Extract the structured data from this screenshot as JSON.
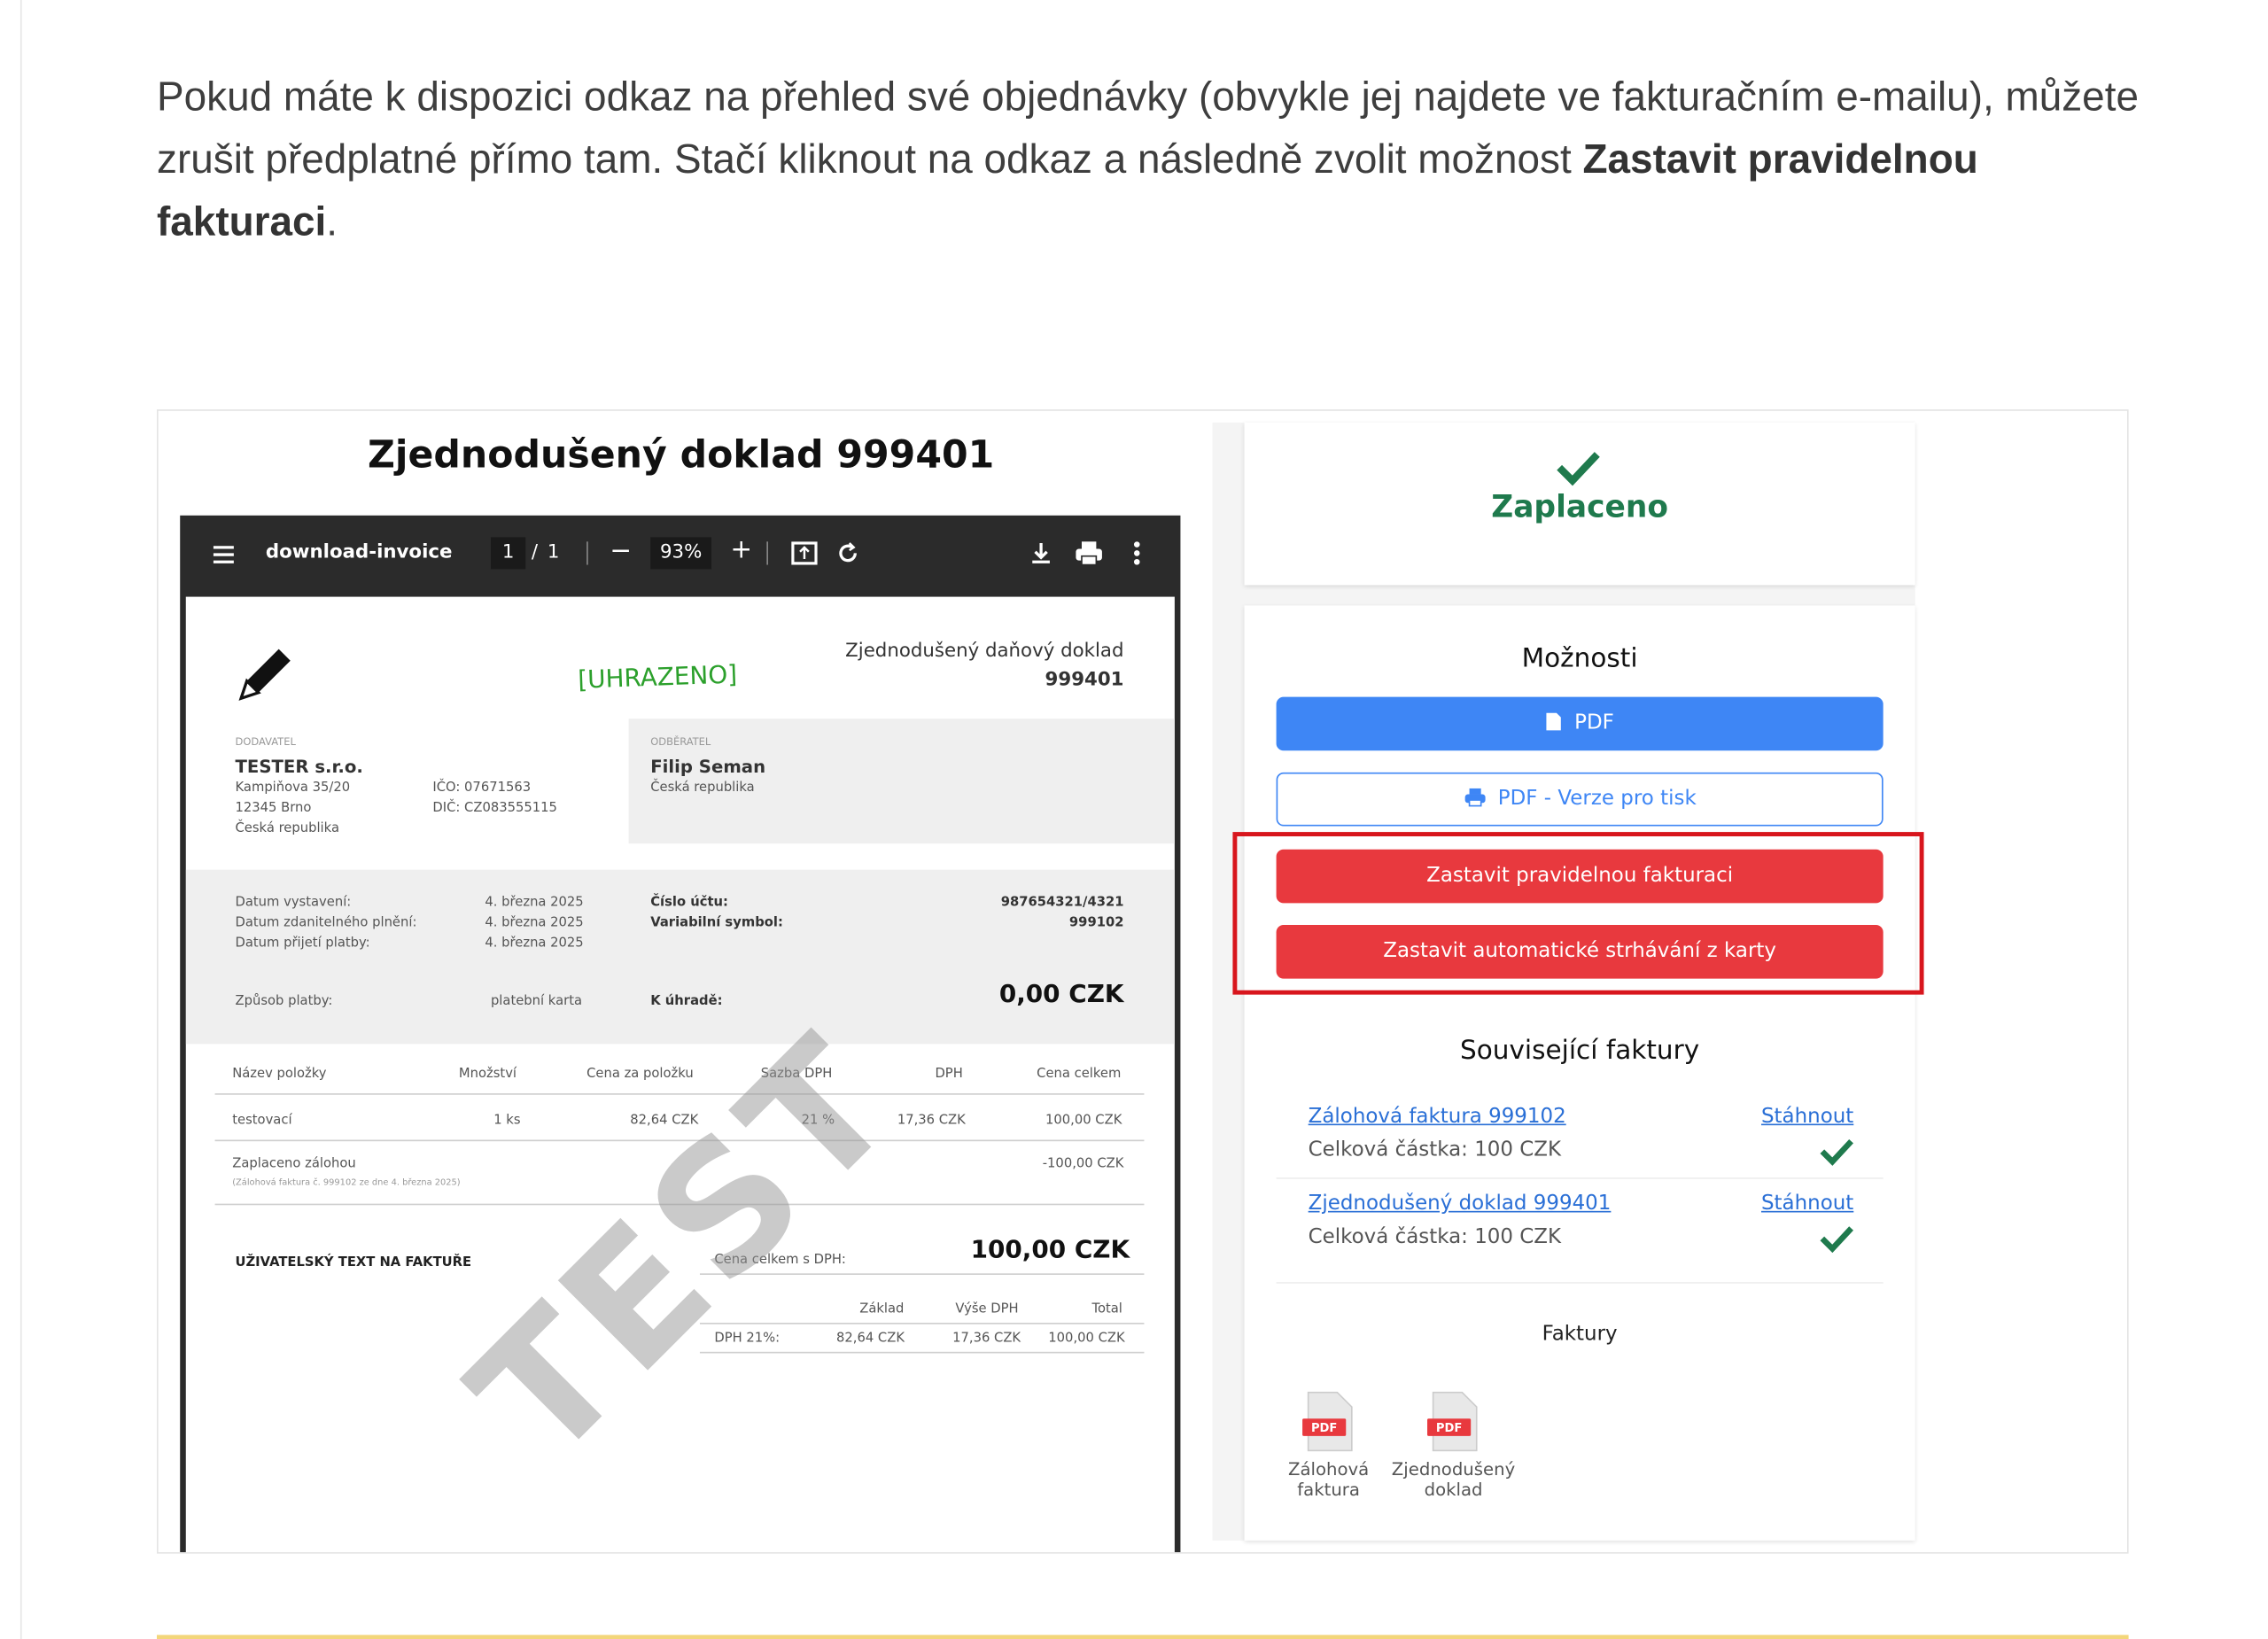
{
  "paragraph": {
    "text": "Pokud máte k dispozici odkaz na přehled své objednávky (obvykle jej najdete ve fakturačním e-mailu), můžete zrušit předplatné přímo tam. Stačí kliknout na odkaz a následně zvolit možnost ",
    "bold": "Zastavit pravidelnou fakturaci",
    "end": "."
  },
  "screenshot": {
    "title": "Zjednodušený doklad 999401",
    "viewer": {
      "filename": "download-invoice",
      "page_current": "1",
      "page_sep": "/",
      "page_total": "1",
      "zoom": "93%",
      "minus": "−",
      "plus": "+"
    },
    "invoice": {
      "stamp": "[UHRAZENO]",
      "doc_type": "Zjednodušený daňový doklad",
      "doc_number": "999401",
      "supplier_hdr": "DODAVATEL",
      "supplier_name": "TESTER s.r.o.",
      "supplier_street": "Kampiňova 35/20",
      "supplier_city": "12345 Brno",
      "supplier_country": "Česká republika",
      "ico": "IČO: 07671563",
      "dic": "DIČ: CZ083555115",
      "customer_hdr": "ODBĚRATEL",
      "customer_name": "Filip Seman",
      "customer_country": "Česká republika",
      "date_issue_l": "Datum vystavení:",
      "date_issue_v": "4. března 2025",
      "date_tax_l": "Datum zdanitelného plnění:",
      "date_tax_v": "4. března 2025",
      "date_pay_l": "Datum přijetí platby:",
      "date_pay_v": "4. března 2025",
      "account_l": "Číslo účtu:",
      "account_v": "987654321/4321",
      "vs_l": "Variabilní symbol:",
      "vs_v": "999102",
      "method_l": "Způsob platby:",
      "method_v": "platební karta",
      "due_l": "K úhradě:",
      "due_v": "0,00 CZK",
      "cols": [
        "Název položky",
        "Množství",
        "Cena za položku",
        "Sazba DPH",
        "DPH",
        "Cena celkem"
      ],
      "row1": [
        "testovací",
        "1 ks",
        "82,64 CZK",
        "21 %",
        "17,36 CZK",
        "100,00 CZK"
      ],
      "row2_name": "Zaplaceno zálohou",
      "row2_sub": "(Zálohová faktura č. 999102 ze dne 4. března 2025)",
      "row2_total": "-100,00 CZK",
      "user_text": "UŽIVATELSKÝ TEXT NA FAKTUŘE",
      "total_l": "Cena celkem s DPH:",
      "total_v": "100,00 CZK",
      "vat_cols": [
        "Základ",
        "Výše DPH",
        "Total"
      ],
      "vat_row": [
        "DPH 21%:",
        "82,64 CZK",
        "17,36 CZK",
        "100,00 CZK"
      ],
      "watermark": "TEST"
    },
    "status": {
      "label": "Zaplaceno"
    },
    "options": {
      "title": "Možnosti",
      "pdf": "PDF",
      "pdf_print": "PDF - Verze pro tisk",
      "stop_billing": "Zastavit pravidelnou fakturaci",
      "stop_card": "Zastavit automatické strhávání z karty"
    },
    "related": {
      "title": "Související faktury",
      "items": [
        {
          "name": "Zálohová faktura 999102",
          "amount": "Celková částka: 100 CZK",
          "action": "Stáhnout"
        },
        {
          "name": "Zjednodušený doklad 999401",
          "amount": "Celková částka: 100 CZK",
          "action": "Stáhnout"
        }
      ]
    },
    "files": {
      "title": "Faktury",
      "badge": "PDF",
      "items": [
        {
          "l1": "Zálohová",
          "l2": "faktura"
        },
        {
          "l1": "Zjednodušený",
          "l2": "doklad"
        }
      ]
    }
  },
  "colors": {
    "green": "#1f7a4d",
    "blue": "#3e86f5",
    "red": "#e8393e",
    "highlight": "#d8161d"
  }
}
